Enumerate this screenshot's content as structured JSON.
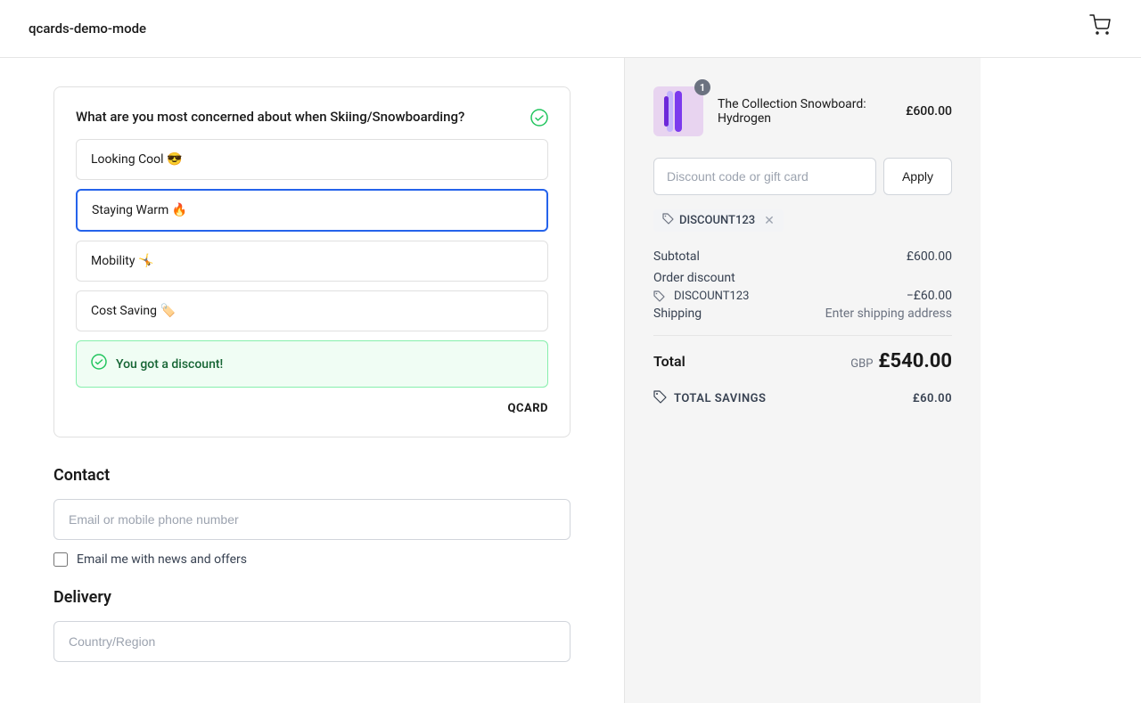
{
  "header": {
    "title": "qcards-demo-mode",
    "cart_icon": "🛍"
  },
  "qcard": {
    "question": "What are you most concerned about when Skiing/Snowboarding?",
    "check_icon": "✓",
    "options": [
      {
        "id": "looking-cool",
        "label": "Looking Cool 😎",
        "selected": false
      },
      {
        "id": "staying-warm",
        "label": "Staying Warm 🔥",
        "selected": true
      },
      {
        "id": "mobility",
        "label": "Mobility 🤸",
        "selected": false
      },
      {
        "id": "cost-saving",
        "label": "Cost Saving 🏷️",
        "selected": false
      }
    ],
    "discount_message": "You got a discount!",
    "footer": "QCARD"
  },
  "contact": {
    "section_title": "Contact",
    "email_placeholder": "Email or mobile phone number",
    "newsletter_label": "Email me with news and offers"
  },
  "delivery": {
    "section_title": "Delivery",
    "country_placeholder": "Country/Region"
  },
  "order": {
    "product": {
      "name": "The Collection Snowboard: Hydrogen",
      "price": "£600.00",
      "badge": "1"
    },
    "discount_placeholder": "Discount code or gift card",
    "apply_label": "Apply",
    "applied_code": "DISCOUNT123",
    "subtotal_label": "Subtotal",
    "subtotal_value": "£600.00",
    "order_discount_label": "Order discount",
    "discount_code_label": "DISCOUNT123",
    "discount_value": "−£60.00",
    "shipping_label": "Shipping",
    "shipping_value": "Enter shipping address",
    "total_label": "Total",
    "total_currency": "GBP",
    "total_amount": "£540.00",
    "savings_label": "TOTAL SAVINGS",
    "savings_amount": "£60.00"
  }
}
